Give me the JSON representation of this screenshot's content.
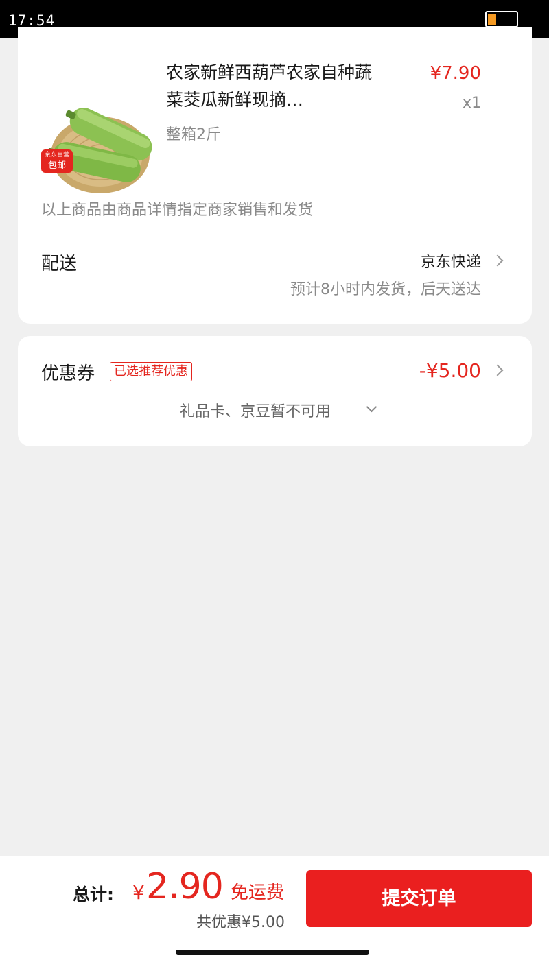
{
  "status_bar": {
    "time": "17:54",
    "battery_level": 0.3,
    "battery_color": "#f59a23"
  },
  "product": {
    "image": "zucchini-basket-image",
    "badge_top": "京东自营",
    "badge_bottom": "包邮",
    "title": "农家新鲜西葫芦农家自种蔬菜茭瓜新鲜现摘…",
    "spec": "整箱2斤",
    "price": "¥7.90",
    "quantity": "x1"
  },
  "seller_note": "以上商品由商品详情指定商家销售和发货",
  "delivery": {
    "label": "配送",
    "method": "京东快递",
    "eta": "预计8小时内发货，后天送达"
  },
  "coupon": {
    "label": "优惠券",
    "tag": "已选推荐优惠",
    "amount": "-¥5.00",
    "giftcard_note": "礼品卡、京豆暂不可用"
  },
  "footer": {
    "total_label": "总计:",
    "currency": "¥",
    "total_amount": "2.90",
    "free_shipping": "免运费",
    "discount_label": "共优惠",
    "discount_amount": "¥5.00",
    "submit_label": "提交订单"
  },
  "colors": {
    "accent_red": "#e4261f",
    "button_red": "#ea1f1f",
    "page_bg": "#f0f0f0"
  }
}
